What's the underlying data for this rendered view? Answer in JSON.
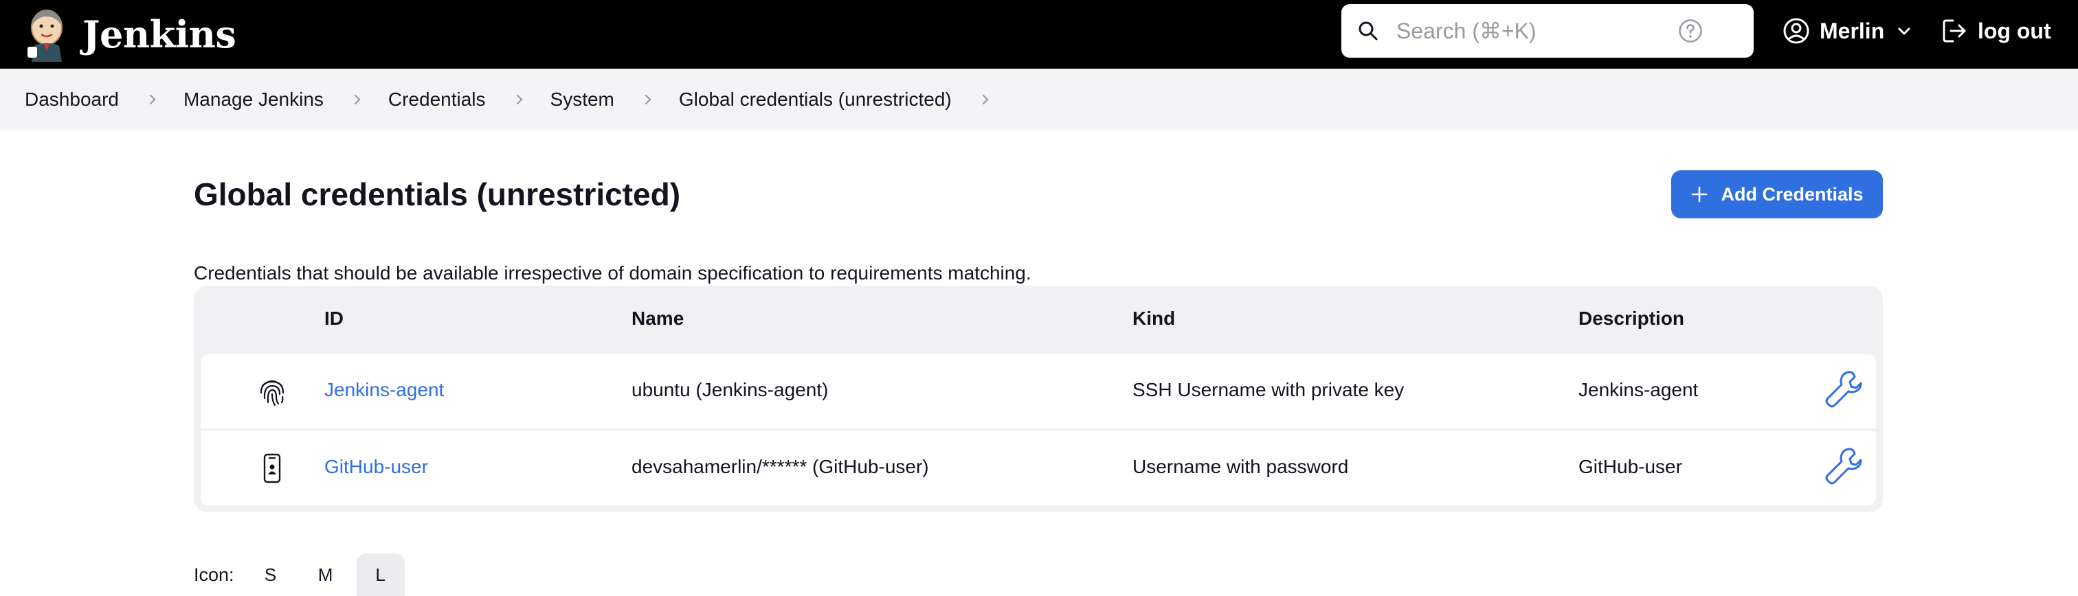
{
  "header": {
    "brand_name": "Jenkins",
    "search_placeholder": "Search (⌘+K)",
    "user_name": "Merlin",
    "logout_label": "log out"
  },
  "breadcrumb": [
    "Dashboard",
    "Manage Jenkins",
    "Credentials",
    "System",
    "Global credentials (unrestricted)"
  ],
  "page": {
    "title": "Global credentials (unrestricted)",
    "add_button_label": "Add Credentials",
    "description": "Credentials that should be available irrespective of domain specification to requirements matching."
  },
  "table": {
    "columns": [
      "ID",
      "Name",
      "Kind",
      "Description"
    ],
    "rows": [
      {
        "icon": "fingerprint-icon",
        "id": "Jenkins-agent",
        "name": "ubuntu (Jenkins-agent)",
        "kind": "SSH Username with private key",
        "description": "Jenkins-agent"
      },
      {
        "icon": "mobile-badge-icon",
        "id": "GitHub-user",
        "name": "devsahamerlin/****** (GitHub-user)",
        "kind": "Username with password",
        "description": "GitHub-user"
      }
    ]
  },
  "icon_size": {
    "label": "Icon:",
    "options": [
      "S",
      "M",
      "L"
    ],
    "selected": "L"
  },
  "colors": {
    "header_bg": "#000000",
    "accent": "#2f6fdf",
    "breadcrumb_bg": "#f4f4f6",
    "table_bg": "#f1f1f4"
  }
}
